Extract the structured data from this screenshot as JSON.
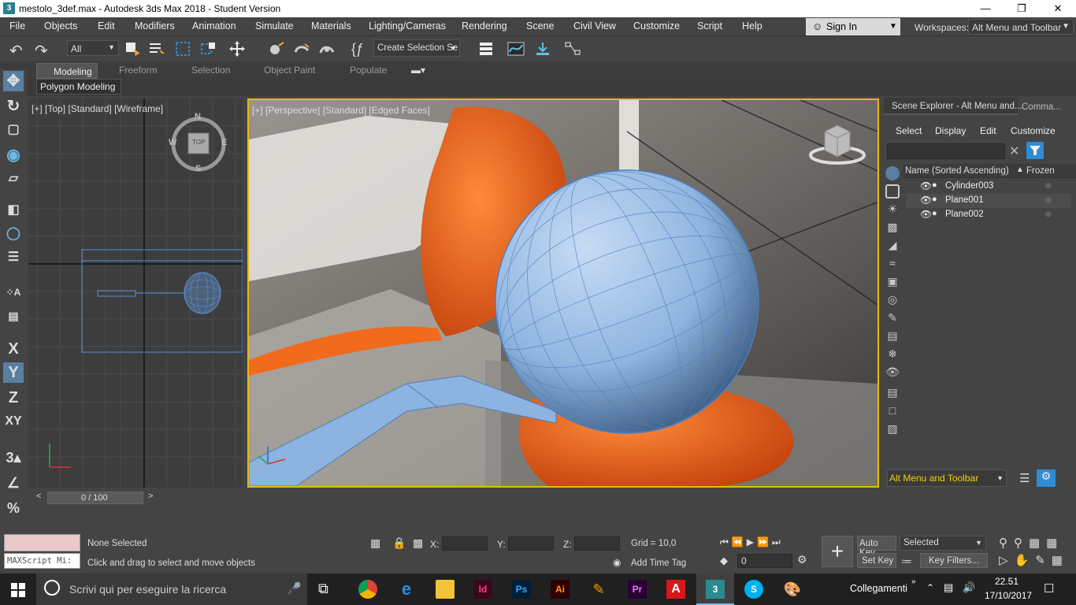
{
  "window": {
    "title": "mestolo_3def.max - Autodesk 3ds Max 2018 - Student Version",
    "app_icon": "3"
  },
  "menubar": {
    "items": [
      "File",
      "Objects",
      "Edit",
      "Modifiers",
      "Animation",
      "Simulate",
      "Materials",
      "Lighting/Cameras",
      "Rendering",
      "Scene",
      "Civil View",
      "Customize",
      "Script",
      "Help"
    ],
    "sign_in": "Sign In",
    "workspaces_label": "Workspaces:",
    "workspace_value": "Alt Menu and Toolbar"
  },
  "toolbar": {
    "filter_value": "All",
    "selection_set_placeholder": "Create Selection Se"
  },
  "ribbon": {
    "tabs": [
      "Modeling",
      "Freeform",
      "Selection",
      "Object Paint",
      "Populate"
    ],
    "active_tab": "Modeling",
    "panel_label": "Polygon Modeling"
  },
  "left_tools": {
    "x": "X",
    "y": "Y",
    "z": "Z",
    "xy": "XY"
  },
  "viewports": {
    "top": {
      "label": "[+] [Top] [Standard] [Wireframe]",
      "compass": {
        "n": "N",
        "s": "S",
        "e": "E",
        "w": "W",
        "center": "TOP"
      }
    },
    "perspective": {
      "label": "[+] [Perspective] [Standard] [Edged Faces]"
    }
  },
  "scene_explorer": {
    "tab_title": "Scene Explorer - Alt Menu and...",
    "tab2": "Comma...",
    "menu": [
      "Select",
      "Display",
      "Edit",
      "Customize"
    ],
    "col_name": "Name (Sorted Ascending)",
    "col_frozen": "Frozen",
    "objects": [
      "Cylinder003",
      "Plane001",
      "Plane002"
    ],
    "workspace_dropdown": "Alt Menu and Toolbar"
  },
  "timeline": {
    "frame": "0 / 100"
  },
  "status": {
    "maxscript": "MAXScript Mi:",
    "selection": "None Selected",
    "hint": "Click and drag to select and move objects",
    "x_label": "X:",
    "y_label": "Y:",
    "z_label": "Z:",
    "grid": "Grid = 10,0",
    "add_time_tag": "Add Time Tag",
    "auto_key": "Auto Key",
    "set_key": "Set Key",
    "key_mode": "Selected",
    "key_filters": "Key Filters...",
    "frame_value": "0"
  },
  "taskbar": {
    "search_placeholder": "Scrivi qui per eseguire la ricerca",
    "links": "Collegamenti",
    "time": "22.51",
    "date": "17/10/2017",
    "apps": [
      "chrome",
      "edge",
      "explorer",
      "Id",
      "Ps",
      "Ai",
      "brush",
      "Pr",
      "acrobat",
      "3ds",
      "skype",
      "paint"
    ]
  },
  "colors": {
    "accent": "#e7b90e",
    "select_blue": "#2e8cd4",
    "sphere": "#8db3e0",
    "orange": "#f26a1b"
  }
}
